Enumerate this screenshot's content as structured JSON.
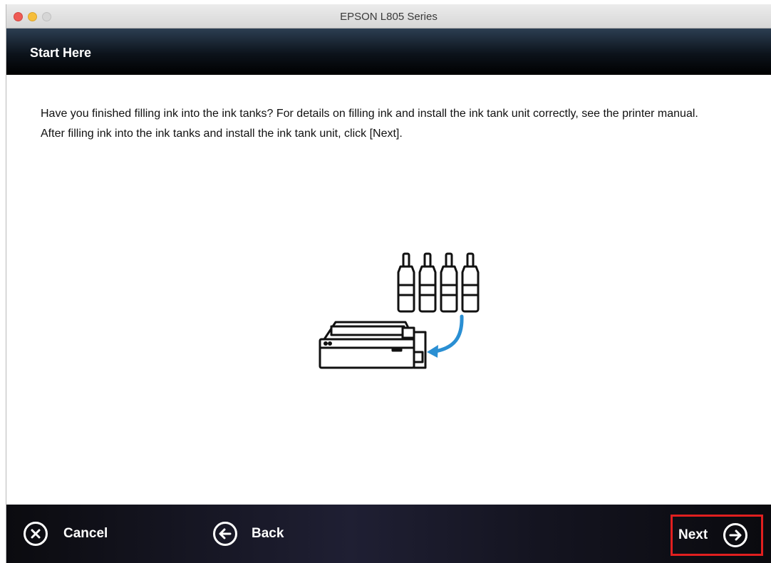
{
  "window": {
    "title": "EPSON L805 Series"
  },
  "header": {
    "title": "Start Here"
  },
  "instructions": {
    "line1": "Have you finished filling ink into the ink tanks? For details on filling ink and install the ink tank unit correctly, see the printer manual.",
    "line2": "After filling ink into the ink tanks and install the ink tank unit, click [Next]."
  },
  "footer": {
    "cancel_label": "Cancel",
    "back_label": "Back",
    "next_label": "Next"
  },
  "icons": {
    "cancel": "x-circle-icon",
    "back": "arrow-left-circle-icon",
    "next": "arrow-right-circle-icon"
  },
  "colors": {
    "highlight": "#e01f1f",
    "arrow": "#2a8fd3"
  }
}
